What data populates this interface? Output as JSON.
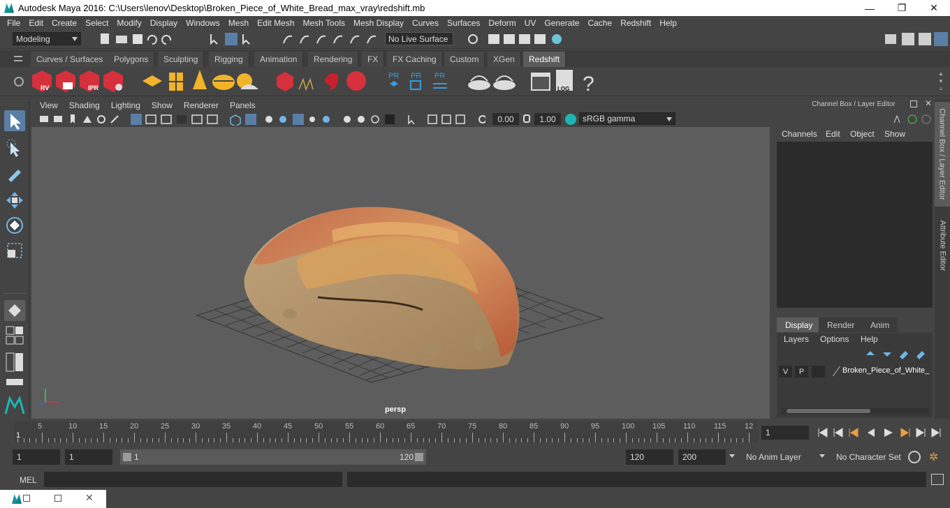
{
  "window": {
    "title": "Autodesk Maya 2016: C:\\Users\\lenov\\Desktop\\Broken_Piece_of_White_Bread_max_vray\\redshift.mb",
    "minimize": "—",
    "maximize": "❐",
    "close": "✕"
  },
  "menubar": [
    "File",
    "Edit",
    "Create",
    "Select",
    "Modify",
    "Display",
    "Windows",
    "Mesh",
    "Edit Mesh",
    "Mesh Tools",
    "Mesh Display",
    "Curves",
    "Surfaces",
    "Deform",
    "UV",
    "Generate",
    "Cache",
    "Redshift",
    "Help"
  ],
  "statusline": {
    "mode": "Modeling",
    "live_surface": "No Live Surface"
  },
  "shelf_tabs": [
    "Curves / Surfaces",
    "Polygons",
    "Sculpting",
    "Rigging",
    "Animation",
    "Rendering",
    "FX",
    "FX Caching",
    "Custom",
    "XGen",
    "Redshift"
  ],
  "shelf_active": "Redshift",
  "shelf_icons": {
    "rv": "RV",
    "ipr": "IPR",
    "pr": "PR",
    "log": "LOG",
    "help": "?"
  },
  "panel_menu": [
    "View",
    "Shading",
    "Lighting",
    "Show",
    "Renderer",
    "Panels"
  ],
  "panel_toolbar": {
    "exposure": "0.00",
    "gamma": "1.00",
    "color_space": "sRGB gamma"
  },
  "viewport": {
    "camera": "persp"
  },
  "channel_box": {
    "title": "Channel Box / Layer Editor",
    "menu": [
      "Channels",
      "Edit",
      "Object",
      "Show"
    ],
    "layer_tabs": [
      "Display",
      "Render",
      "Anim"
    ],
    "layer_active": "Display",
    "layer_menu": [
      "Layers",
      "Options",
      "Help"
    ],
    "layer": {
      "v": "V",
      "p": "P",
      "name": "Broken_Piece_of_White_"
    }
  },
  "side_tabs": [
    "Channel Box / Layer Editor",
    "Attribute Editor"
  ],
  "time_slider": {
    "labels": [
      "5",
      "10",
      "15",
      "20",
      "25",
      "30",
      "35",
      "40",
      "45",
      "50",
      "55",
      "60",
      "65",
      "70",
      "75",
      "80",
      "85",
      "90",
      "95",
      "100",
      "105",
      "110",
      "115",
      "12"
    ],
    "start_label": "1",
    "current_frame": "1"
  },
  "range": {
    "start": "1",
    "playback_start": "1",
    "slider_start": "1",
    "slider_end": "120",
    "playback_end": "120",
    "end": "200",
    "anim_layer": "No Anim Layer",
    "character_set": "No Character Set"
  },
  "command_line": {
    "label": "MEL"
  },
  "colors": {
    "accent_tab": "#5b5b5b",
    "redshift_red": "#d6303c",
    "gold": "#f0b429",
    "pr_blue": "#3a9bd9"
  }
}
